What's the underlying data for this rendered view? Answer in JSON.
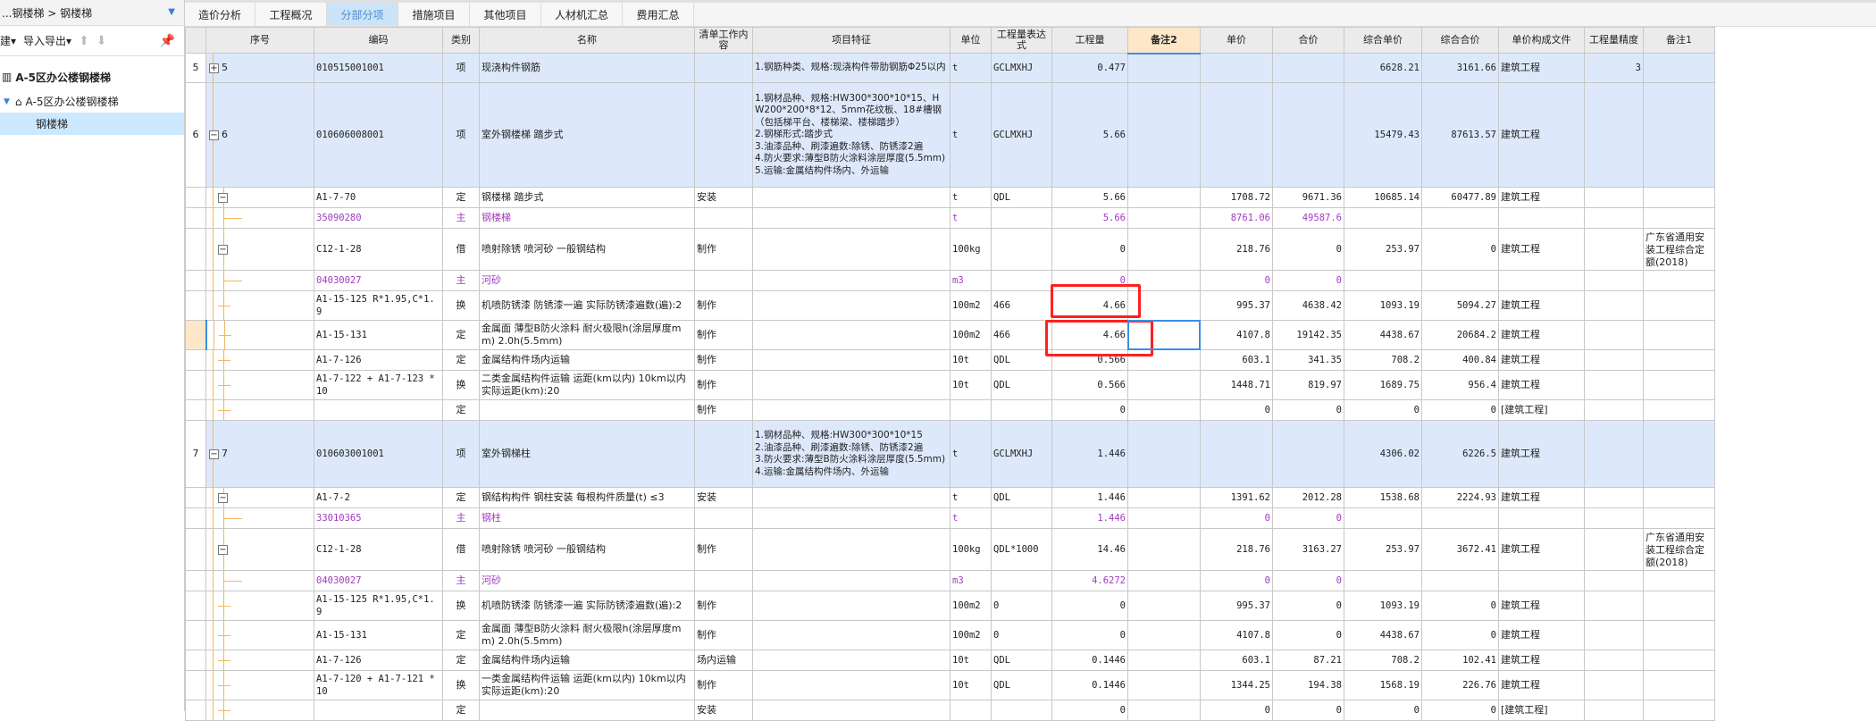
{
  "sidebar": {
    "breadcrumb": "...钢楼梯 > 钢楼梯",
    "new_label": "建▾",
    "import_export_label": "导入导出▾",
    "tree": [
      {
        "label": "A-5区办公楼钢楼梯",
        "icon": "building-icon"
      },
      {
        "label": "A-5区办公楼钢楼梯",
        "icon": "home-icon"
      },
      {
        "label": "钢楼梯"
      }
    ]
  },
  "tabs": [
    {
      "label": "造价分析"
    },
    {
      "label": "工程概况"
    },
    {
      "label": "分部分项",
      "active": true
    },
    {
      "label": "措施项目"
    },
    {
      "label": "其他项目"
    },
    {
      "label": "人材机汇总"
    },
    {
      "label": "费用汇总"
    }
  ],
  "columns": [
    "",
    "序号",
    "编码",
    "类别",
    "名称",
    "清单工作内容",
    "项目特征",
    "单位",
    "工程量表达式",
    "工程量",
    "备注2",
    "单价",
    "合价",
    "综合单价",
    "综合合价",
    "单价构成文件",
    "工程量精度",
    "备注1"
  ],
  "rows": [
    {
      "k": "item",
      "rh": "5",
      "seq": "5",
      "tog": "+",
      "code": "010515001001",
      "type": "项",
      "name": "现浇构件钢筋",
      "content": "",
      "feature": "1.钢筋种类、规格:现浇构件带肋钢筋Φ25以内",
      "unit": "t",
      "expr": "GCLMXHJ",
      "qty": "0.477",
      "note2": "",
      "price": "",
      "total": "",
      "cprice": "6628.21",
      "ctotal": "3161.66",
      "file": "建筑工程",
      "prec": "3",
      "note1": ""
    },
    {
      "k": "item",
      "rh": "6",
      "seq": "6",
      "tog": "-",
      "code": "010606008001",
      "type": "项",
      "name": "室外钢楼梯 踏步式",
      "content": "",
      "feature": "1.钢材品种、规格:HW300*300*10*15、HW200*200*8*12、5mm花纹板、18#槽钢（包括梯平台、楼梯梁、楼梯踏步）\n2.钢梯形式:踏步式\n3.油漆品种、刷漆遍数:除锈、防锈漆2遍\n4.防火要求:薄型B防火涂料涂层厚度(5.5mm)\n5.运输:金属结构件场内、外运输",
      "unit": "t",
      "expr": "GCLMXHJ",
      "qty": "5.66",
      "note2": "",
      "price": "",
      "total": "",
      "cprice": "15479.43",
      "ctotal": "87613.57",
      "file": "建筑工程",
      "prec": "",
      "note1": ""
    },
    {
      "k": "quota",
      "rh": "",
      "seq": "",
      "tog": "-",
      "code": "A1-7-70",
      "type": "定",
      "name": "钢楼梯 踏步式",
      "content": "安装",
      "feature": "",
      "unit": "t",
      "expr": "QDL",
      "qty": "5.66",
      "note2": "",
      "price": "1708.72",
      "total": "9671.36",
      "cprice": "10685.14",
      "ctotal": "60477.89",
      "file": "建筑工程",
      "prec": "",
      "note1": ""
    },
    {
      "k": "mainmat",
      "rh": "",
      "seq": "",
      "tog": "",
      "sub": true,
      "code": "35090280",
      "type": "主",
      "name": "钢楼梯",
      "content": "",
      "feature": "",
      "unit": "t",
      "expr": "",
      "qty": "5.66",
      "note2": "",
      "price": "8761.06",
      "total": "49587.6",
      "cprice": "",
      "ctotal": "",
      "file": "",
      "prec": "",
      "note1": ""
    },
    {
      "k": "quota",
      "rh": "",
      "seq": "",
      "tog": "-",
      "code": "C12-1-28",
      "type": "借",
      "name": "喷射除锈 喷河砂 一般钢结构",
      "content": "制作",
      "feature": "",
      "unit": "100kg",
      "expr": "",
      "qty": "0",
      "note2": "",
      "price": "218.76",
      "total": "0",
      "cprice": "253.97",
      "ctotal": "0",
      "file": "建筑工程",
      "prec": "",
      "note1": "广东省通用安装工程综合定额(2018)"
    },
    {
      "k": "mainmat",
      "rh": "",
      "seq": "",
      "tog": "",
      "sub": true,
      "code": "04030027",
      "type": "主",
      "name": "河砂",
      "content": "",
      "feature": "",
      "unit": "m3",
      "expr": "",
      "qty": "0",
      "note2": "",
      "price": "0",
      "total": "0",
      "cprice": "",
      "ctotal": "",
      "file": "",
      "prec": "",
      "note1": ""
    },
    {
      "k": "quota",
      "rh": "",
      "seq": "",
      "tog": "",
      "code": "A1-15-125 R*1.95,C*1.9",
      "type": "换",
      "name": "机喷防锈漆 防锈漆一遍  实际防锈漆遍数(遍):2",
      "content": "制作",
      "feature": "",
      "unit": "100m2",
      "expr": "466",
      "qty": "4.66",
      "note2": "",
      "price": "995.37",
      "total": "4638.42",
      "cprice": "1093.19",
      "ctotal": "5094.27",
      "file": "建筑工程",
      "prec": "",
      "note1": ""
    },
    {
      "k": "quota",
      "rh": "",
      "sel": true,
      "seq": "",
      "tog": "",
      "code": "A1-15-131",
      "type": "定",
      "name": "金属面 薄型B防火涂料 耐火极限h(涂层厚度mm) 2.0h(5.5mm)",
      "content": "制作",
      "feature": "",
      "unit": "100m2",
      "expr": "466",
      "qty": "4.66",
      "note2": "",
      "price": "4107.8",
      "total": "19142.35",
      "cprice": "4438.67",
      "ctotal": "20684.2",
      "file": "建筑工程",
      "prec": "",
      "note1": ""
    },
    {
      "k": "quota",
      "rh": "",
      "seq": "",
      "tog": "",
      "code": "A1-7-126",
      "type": "定",
      "name": "金属结构件场内运输",
      "content": "制作",
      "feature": "",
      "unit": "10t",
      "expr": "QDL",
      "qty": "0.566",
      "note2": "",
      "price": "603.1",
      "total": "341.35",
      "cprice": "708.2",
      "ctotal": "400.84",
      "file": "建筑工程",
      "prec": "",
      "note1": ""
    },
    {
      "k": "quota",
      "rh": "",
      "seq": "",
      "tog": "",
      "code": "A1-7-122 + A1-7-123 * 10",
      "type": "换",
      "name": "二类金属结构件运输 运距(km以内) 10km以内  实际运距(km):20",
      "content": "制作",
      "feature": "",
      "unit": "10t",
      "expr": "QDL",
      "qty": "0.566",
      "note2": "",
      "price": "1448.71",
      "total": "819.97",
      "cprice": "1689.75",
      "ctotal": "956.4",
      "file": "建筑工程",
      "prec": "",
      "note1": ""
    },
    {
      "k": "quota",
      "rh": "",
      "seq": "",
      "tog": "",
      "code": "",
      "type": "定",
      "name": "",
      "content": "制作",
      "feature": "",
      "unit": "",
      "expr": "",
      "qty": "0",
      "note2": "",
      "price": "0",
      "total": "0",
      "cprice": "0",
      "ctotal": "0",
      "file": "[建筑工程]",
      "prec": "",
      "note1": ""
    },
    {
      "k": "item",
      "rh": "7",
      "seq": "7",
      "tog": "-",
      "code": "010603001001",
      "type": "项",
      "name": "室外钢梯柱",
      "content": "",
      "feature": "1.钢材品种、规格:HW300*300*10*15\n2.油漆品种、刷漆遍数:除锈、防锈漆2遍\n3.防火要求:薄型B防火涂料涂层厚度(5.5mm)\n4.运输:金属结构件场内、外运输",
      "unit": "t",
      "expr": "GCLMXHJ",
      "qty": "1.446",
      "note2": "",
      "price": "",
      "total": "",
      "cprice": "4306.02",
      "ctotal": "6226.5",
      "file": "建筑工程",
      "prec": "",
      "note1": ""
    },
    {
      "k": "quota",
      "rh": "",
      "seq": "",
      "tog": "-",
      "code": "A1-7-2",
      "type": "定",
      "name": "钢结构构件 钢柱安装 每根构件质量(t) ≤3",
      "content": "安装",
      "feature": "",
      "unit": "t",
      "expr": "QDL",
      "qty": "1.446",
      "note2": "",
      "price": "1391.62",
      "total": "2012.28",
      "cprice": "1538.68",
      "ctotal": "2224.93",
      "file": "建筑工程",
      "prec": "",
      "note1": ""
    },
    {
      "k": "mainmat",
      "rh": "",
      "seq": "",
      "tog": "",
      "sub": true,
      "code": "33010365",
      "type": "主",
      "name": "钢柱",
      "content": "",
      "feature": "",
      "unit": "t",
      "expr": "",
      "qty": "1.446",
      "note2": "",
      "price": "0",
      "total": "0",
      "cprice": "",
      "ctotal": "",
      "file": "",
      "prec": "",
      "note1": ""
    },
    {
      "k": "quota",
      "rh": "",
      "seq": "",
      "tog": "-",
      "code": "C12-1-28",
      "type": "借",
      "name": "喷射除锈 喷河砂 一般钢结构",
      "content": "制作",
      "feature": "",
      "unit": "100kg",
      "expr": "QDL*1000",
      "qty": "14.46",
      "note2": "",
      "price": "218.76",
      "total": "3163.27",
      "cprice": "253.97",
      "ctotal": "3672.41",
      "file": "建筑工程",
      "prec": "",
      "note1": "广东省通用安装工程综合定额(2018)"
    },
    {
      "k": "mainmat",
      "rh": "",
      "seq": "",
      "tog": "",
      "sub": true,
      "code": "04030027",
      "type": "主",
      "name": "河砂",
      "content": "",
      "feature": "",
      "unit": "m3",
      "expr": "",
      "qty": "4.6272",
      "note2": "",
      "price": "0",
      "total": "0",
      "cprice": "",
      "ctotal": "",
      "file": "",
      "prec": "",
      "note1": ""
    },
    {
      "k": "quota",
      "rh": "",
      "seq": "",
      "tog": "",
      "code": "A1-15-125 R*1.95,C*1.9",
      "type": "换",
      "name": "机喷防锈漆 防锈漆一遍  实际防锈漆遍数(遍):2",
      "content": "制作",
      "feature": "",
      "unit": "100m2",
      "expr": "0",
      "qty": "0",
      "note2": "",
      "price": "995.37",
      "total": "0",
      "cprice": "1093.19",
      "ctotal": "0",
      "file": "建筑工程",
      "prec": "",
      "note1": ""
    },
    {
      "k": "quota",
      "rh": "",
      "seq": "",
      "tog": "",
      "code": "A1-15-131",
      "type": "定",
      "name": "金属面 薄型B防火涂料 耐火极限h(涂层厚度mm) 2.0h(5.5mm)",
      "content": "制作",
      "feature": "",
      "unit": "100m2",
      "expr": "0",
      "qty": "0",
      "note2": "",
      "price": "4107.8",
      "total": "0",
      "cprice": "4438.67",
      "ctotal": "0",
      "file": "建筑工程",
      "prec": "",
      "note1": ""
    },
    {
      "k": "quota",
      "rh": "",
      "seq": "",
      "tog": "",
      "code": "A1-7-126",
      "type": "定",
      "name": "金属结构件场内运输",
      "content": "场内运输",
      "feature": "",
      "unit": "10t",
      "expr": "QDL",
      "qty": "0.1446",
      "note2": "",
      "price": "603.1",
      "total": "87.21",
      "cprice": "708.2",
      "ctotal": "102.41",
      "file": "建筑工程",
      "prec": "",
      "note1": ""
    },
    {
      "k": "quota",
      "rh": "",
      "seq": "",
      "tog": "",
      "code": "A1-7-120 + A1-7-121 * 10",
      "type": "换",
      "name": "一类金属结构件运输 运距(km以内) 10km以内  实际运距(km):20",
      "content": "制作",
      "feature": "",
      "unit": "10t",
      "expr": "QDL",
      "qty": "0.1446",
      "note2": "",
      "price": "1344.25",
      "total": "194.38",
      "cprice": "1568.19",
      "ctotal": "226.76",
      "file": "建筑工程",
      "prec": "",
      "note1": ""
    },
    {
      "k": "quota",
      "rh": "",
      "seq": "",
      "tog": "",
      "code": "",
      "type": "定",
      "name": "",
      "content": "安装",
      "feature": "",
      "unit": "",
      "expr": "",
      "qty": "0",
      "note2": "",
      "price": "0",
      "total": "0",
      "cprice": "0",
      "ctotal": "0",
      "file": "[建筑工程]",
      "prec": "",
      "note1": ""
    }
  ],
  "colors": {
    "item_row": "#dde9fb",
    "main_material": "#a23bc0",
    "highlight_box": "#ff2020",
    "selection": "#3a8ee6"
  }
}
